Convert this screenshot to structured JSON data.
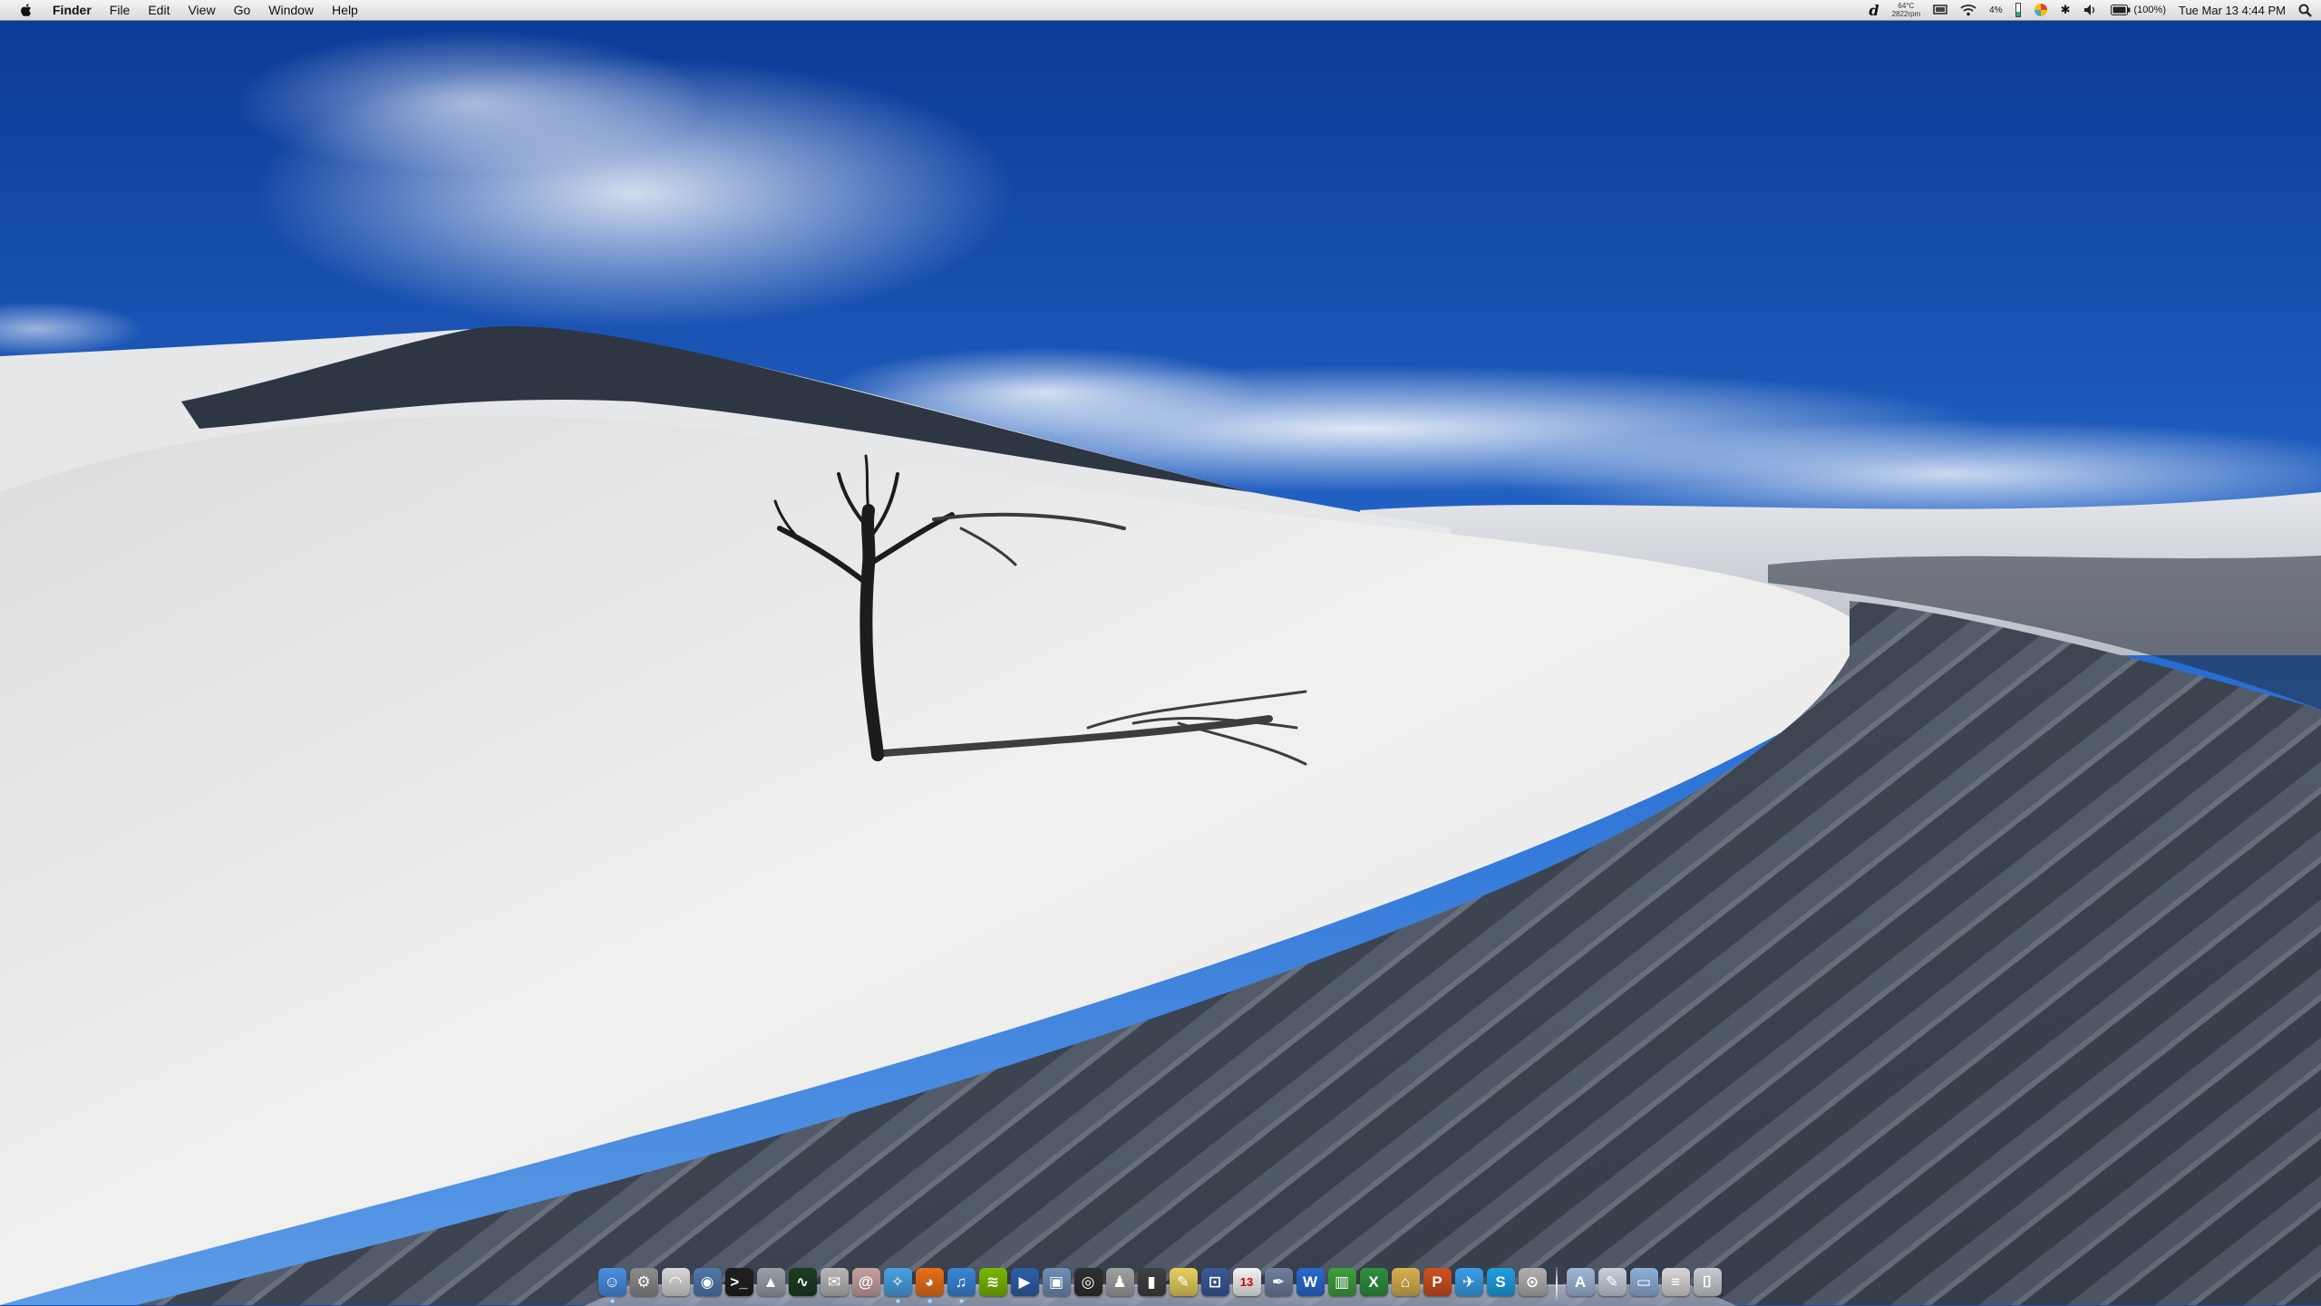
{
  "menubar": {
    "apple_icon": "apple-icon",
    "app_name": "Finder",
    "menus": [
      "File",
      "Edit",
      "View",
      "Go",
      "Window",
      "Help"
    ],
    "status": {
      "dashboard_icon": "dashboard-icon",
      "temperature": "64°C",
      "fan_speed": "2822rpm",
      "display_icon": "display-icon",
      "wifi_icon": "wifi-icon",
      "cpu_usage": "4%",
      "memory_icon": "memory-icon",
      "ical_icon": "colorful-circle-icon",
      "bluetooth_icon": "bluetooth-icon",
      "volume_icon": "volume-icon",
      "battery_icon": "battery-icon",
      "battery_percent": "(100%)",
      "clock": "Tue Mar 13  4:44 PM",
      "spotlight_icon": "spotlight-search-icon"
    }
  },
  "desktop": {
    "wallpaper": "white sand dune with dead tree under blue sky",
    "colors": {
      "sky_top": "#0e3f9e",
      "sky_mid": "#2a6fd6",
      "sand_light": "#efefee",
      "sand_shadow": "#3c4452"
    }
  },
  "dock": {
    "items": [
      {
        "name": "finder",
        "icon": "finder-icon",
        "color": "#4a8fe0",
        "glyph": "☺",
        "running": true
      },
      {
        "name": "system-preferences",
        "icon": "gear-icon",
        "color": "#8c8c8c",
        "glyph": "⚙",
        "running": false
      },
      {
        "name": "airport-utility",
        "icon": "wifi-icon",
        "color": "#d8d8d8",
        "glyph": "◠",
        "running": false
      },
      {
        "name": "disk-utility",
        "icon": "disk-icon",
        "color": "#5078a8",
        "glyph": "◉",
        "running": false
      },
      {
        "name": "terminal",
        "icon": "terminal-icon",
        "color": "#202020",
        "glyph": ">_",
        "running": false
      },
      {
        "name": "app-store",
        "icon": "app-store-icon",
        "color": "#9aa0a8",
        "glyph": "▲",
        "running": false
      },
      {
        "name": "activity-monitor",
        "icon": "activity-monitor-icon",
        "color": "#1d3d22",
        "glyph": "∿",
        "running": false
      },
      {
        "name": "mail-stamp",
        "icon": "mail-icon",
        "color": "#b8b8b8",
        "glyph": "✉",
        "running": false
      },
      {
        "name": "address-book",
        "icon": "address-book-icon",
        "color": "#c8a0a0",
        "glyph": "@",
        "running": false
      },
      {
        "name": "safari",
        "icon": "compass-icon",
        "color": "#4aa2e0",
        "glyph": "✧",
        "running": true
      },
      {
        "name": "firefox",
        "icon": "firefox-icon",
        "color": "#e8701a",
        "glyph": "◕",
        "running": true
      },
      {
        "name": "itunes",
        "icon": "music-note-icon",
        "color": "#3b86d6",
        "glyph": "♫",
        "running": true
      },
      {
        "name": "spotify",
        "icon": "spotify-icon",
        "color": "#7ab800",
        "glyph": "≋",
        "running": false
      },
      {
        "name": "quicktime",
        "icon": "play-icon",
        "color": "#2f5fa8",
        "glyph": "▶",
        "running": false
      },
      {
        "name": "iphoto",
        "icon": "photo-icon",
        "color": "#6f8fb3",
        "glyph": "▣",
        "running": false
      },
      {
        "name": "dvd-player",
        "icon": "dvd-icon",
        "color": "#303030",
        "glyph": "◎",
        "running": false
      },
      {
        "name": "automator",
        "icon": "automator-icon",
        "color": "#a0a0a0",
        "glyph": "♟",
        "running": false
      },
      {
        "name": "ipod",
        "icon": "ipod-icon",
        "color": "#404040",
        "glyph": "▮",
        "running": false
      },
      {
        "name": "stickies",
        "icon": "note-icon",
        "color": "#e8d060",
        "glyph": "✎",
        "running": false
      },
      {
        "name": "virtualbox",
        "icon": "virtual-machine-icon",
        "color": "#3a5a9a",
        "glyph": "⊡",
        "running": false
      },
      {
        "name": "ical",
        "icon": "calendar-icon",
        "color": "#f4f4f4",
        "glyph": "13",
        "running": false
      },
      {
        "name": "xcode-instruments",
        "icon": "pen-icon",
        "color": "#6f7f9f",
        "glyph": "✒",
        "running": false
      },
      {
        "name": "word",
        "icon": "word-icon",
        "color": "#2a6ad0",
        "glyph": "W",
        "running": false
      },
      {
        "name": "numbers",
        "icon": "chart-icon",
        "color": "#3f9f3f",
        "glyph": "▥",
        "running": false
      },
      {
        "name": "excel",
        "icon": "excel-icon",
        "color": "#2f8f3f",
        "glyph": "X",
        "running": false
      },
      {
        "name": "keynote",
        "icon": "keynote-icon",
        "color": "#d8b050",
        "glyph": "⌂",
        "running": false
      },
      {
        "name": "powerpoint",
        "icon": "powerpoint-icon",
        "color": "#d05020",
        "glyph": "P",
        "running": false
      },
      {
        "name": "twitter",
        "icon": "bird-icon",
        "color": "#3aa0e8",
        "glyph": "✈",
        "running": false
      },
      {
        "name": "skype",
        "icon": "skype-icon",
        "color": "#1ea0e0",
        "glyph": "S",
        "running": false
      },
      {
        "name": "utility",
        "icon": "pin-icon",
        "color": "#b0b0b0",
        "glyph": "⊙",
        "running": false
      },
      {
        "name": "applications-folder",
        "icon": "applications-folder-icon",
        "color": "#9fb8d8",
        "glyph": "A",
        "running": false
      },
      {
        "name": "documents-folder",
        "icon": "documents-icon",
        "color": "#c8d0dc",
        "glyph": "✎",
        "running": false
      },
      {
        "name": "downloads-folder",
        "icon": "folder-icon",
        "color": "#8fb0d8",
        "glyph": "▭",
        "running": false
      },
      {
        "name": "stack",
        "icon": "stack-icon",
        "color": "#d8d8d8",
        "glyph": "≡",
        "running": false
      },
      {
        "name": "trash",
        "icon": "trash-icon",
        "color": "#c8ccd2",
        "glyph": "⌷",
        "running": false
      }
    ]
  }
}
